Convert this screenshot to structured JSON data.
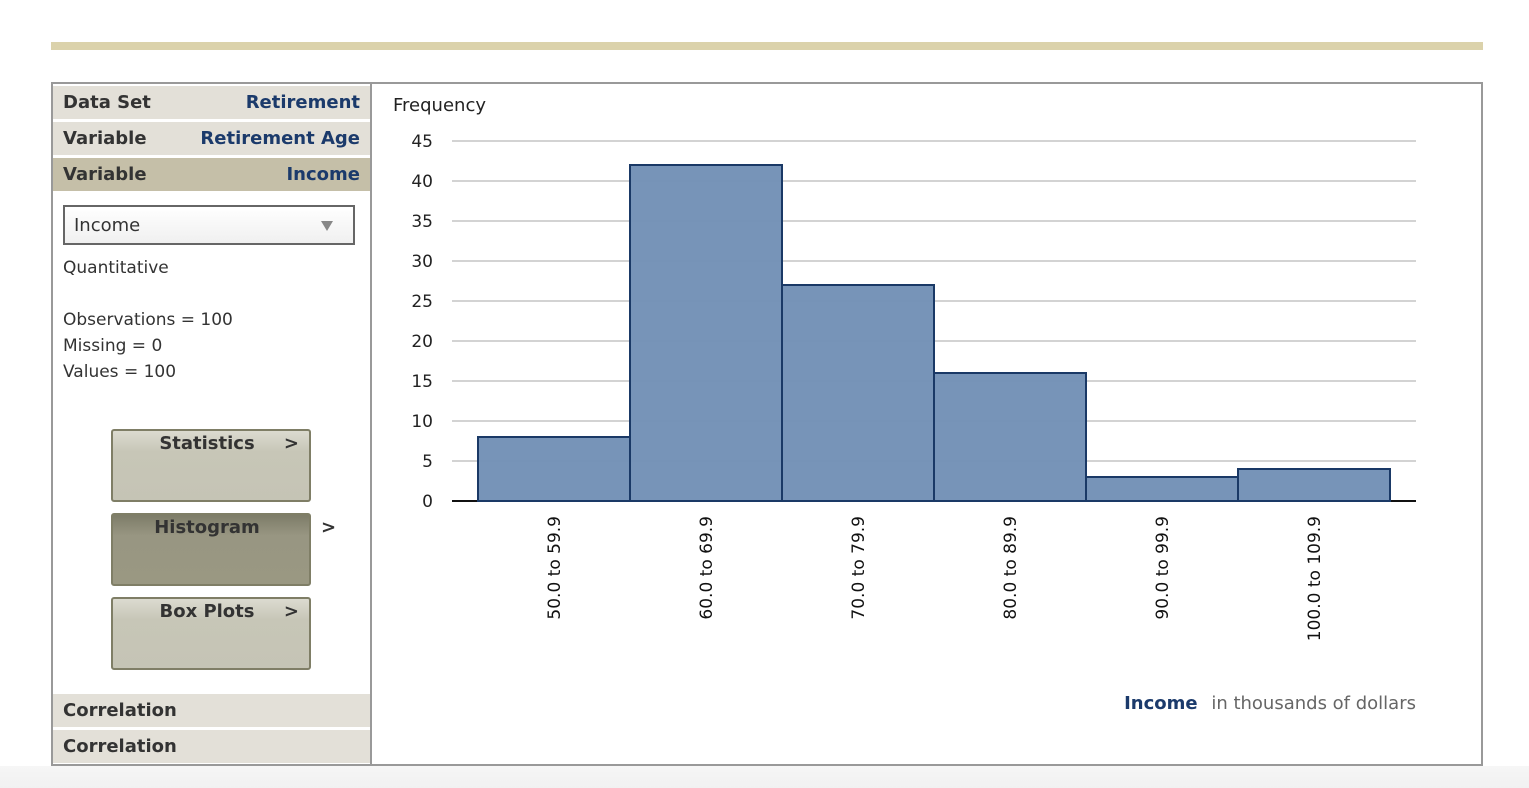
{
  "sidebar": {
    "rows": [
      {
        "label": "Data Set",
        "value": "Retirement"
      },
      {
        "label": "Variable",
        "value": "Retirement Age"
      },
      {
        "label": "Variable",
        "value": "Income"
      }
    ],
    "variable_select": {
      "selected": "Income"
    },
    "variable_type": "Quantitative",
    "stats": {
      "observations": "Observations = 100",
      "missing": "Missing = 0",
      "values": "Values = 100"
    },
    "buttons": [
      {
        "label": "Statistics",
        "chevron": ">"
      },
      {
        "label": "Histogram",
        "chevron": ">"
      },
      {
        "label": "Box Plots",
        "chevron": ">"
      }
    ],
    "bottom_rows": [
      {
        "label": "Correlation"
      },
      {
        "label": "Correlation"
      }
    ]
  },
  "colors": {
    "bar_fill": "#7492b7",
    "bar_stroke": "#1a3966",
    "accent_text": "#1b3a6b",
    "gold": "#dbd2ab",
    "gridline": "#d3d3d3"
  },
  "chart_data": {
    "type": "bar",
    "subtype": "histogram",
    "title": "",
    "ylabel": "Frequency",
    "xlabel_bold": "Income",
    "xlabel_rest": "in thousands of dollars",
    "categories": [
      "50.0 to 59.9",
      "60.0 to 69.9",
      "70.0 to 79.9",
      "80.0 to 89.9",
      "90.0 to 99.9",
      "100.0 to 109.9"
    ],
    "values": [
      8,
      42,
      27,
      16,
      3,
      4
    ],
    "ylim": [
      0,
      45
    ],
    "yticks": [
      0,
      5,
      10,
      15,
      20,
      25,
      30,
      35,
      40,
      45
    ],
    "grid": true,
    "legend": "none"
  }
}
